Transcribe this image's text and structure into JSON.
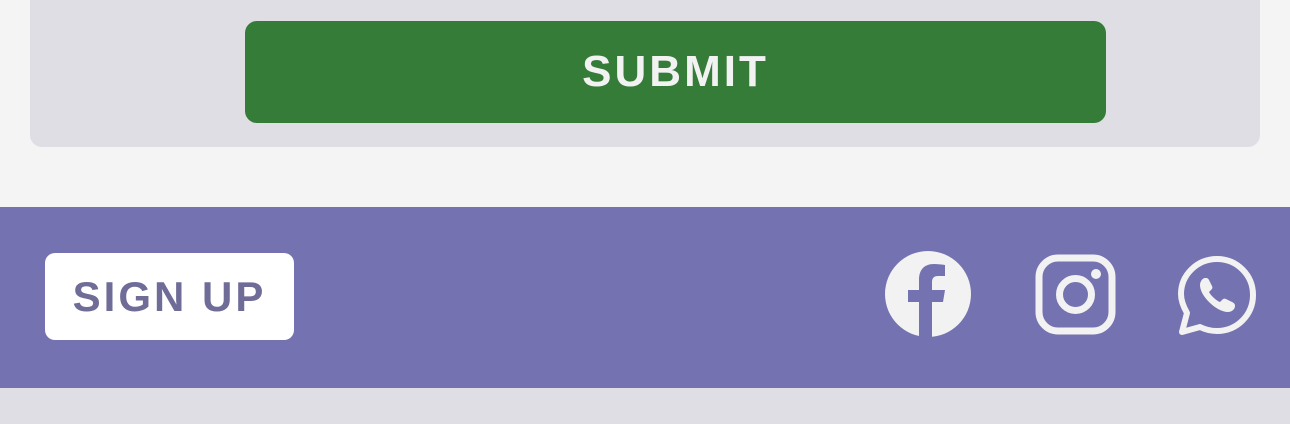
{
  "form": {
    "submit_label": "SUBMIT"
  },
  "footer": {
    "signup_label": "SIGN UP",
    "social_icons": [
      "facebook-icon",
      "instagram-icon",
      "whatsapp-icon"
    ]
  },
  "colors": {
    "submit_bg": "#347c37",
    "footer_bg": "#7472b0",
    "card_bg": "#dfdee5",
    "page_bg": "#f4f4f4",
    "icon_color": "#f2f2f2"
  }
}
